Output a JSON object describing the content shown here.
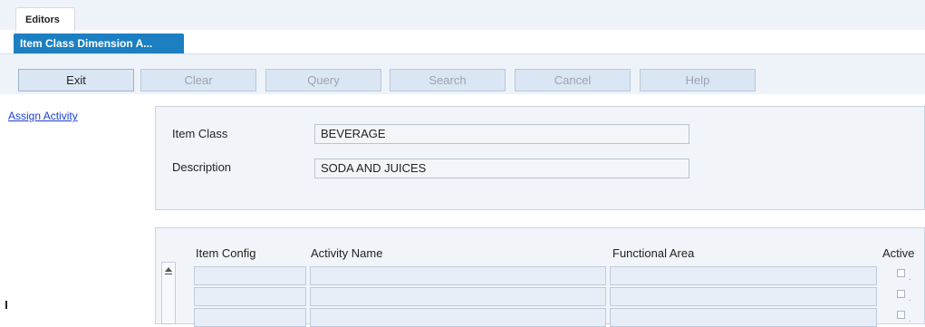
{
  "tabs": {
    "editors_label": "Editors",
    "active_screen_label": "Item Class Dimension A..."
  },
  "toolbar": {
    "exit": "Exit",
    "clear": "Clear",
    "query": "Query",
    "search": "Search",
    "cancel": "Cancel",
    "help": "Help"
  },
  "sidebar": {
    "assign_activity": "Assign Activity"
  },
  "form": {
    "item_class_label": "Item Class",
    "item_class_value": "BEVERAGE",
    "description_label": "Description",
    "description_value": "SODA AND JUICES"
  },
  "grid": {
    "headers": {
      "item_config": "Item Config",
      "activity_name": "Activity Name",
      "functional_area": "Functional Area",
      "active": "Active"
    },
    "rows": [
      {
        "item_config": "",
        "activity_name": "",
        "functional_area": "",
        "active": false
      },
      {
        "item_config": "",
        "activity_name": "",
        "functional_area": "",
        "active": false
      },
      {
        "item_config": "",
        "activity_name": "",
        "functional_area": "",
        "active": false
      }
    ]
  },
  "colors": {
    "active_tab": "#1b7fc1",
    "toolbar_button": "#dbe6f4",
    "link": "#1a3fd0"
  }
}
